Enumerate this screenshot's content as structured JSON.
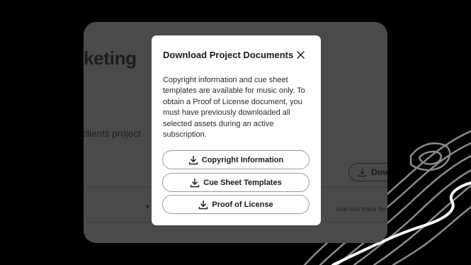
{
  "background": {
    "project_title": "arketing",
    "project_subtitle": "e clients project",
    "download_button_label": "Dow",
    "use_track_text": "Use this track for"
  },
  "modal": {
    "title": "Download Project Documents",
    "close_icon": "close-icon",
    "body": "Copyright information and cue sheet templates are available for music only. To obtain a Proof of License document, you must have previously downloaded all selected assets during an active subscription.",
    "buttons": [
      {
        "label": "Copyright Information",
        "icon": "download-icon"
      },
      {
        "label": "Cue Sheet Templates",
        "icon": "download-icon"
      },
      {
        "label": "Proof of License",
        "icon": "download-icon"
      }
    ]
  },
  "colors": {
    "page_background": "#000000",
    "dimmed_panel": "#4a4a4a",
    "modal_background": "#ffffff",
    "button_border": "#9a9a9a",
    "text": "#1a1a1a"
  }
}
